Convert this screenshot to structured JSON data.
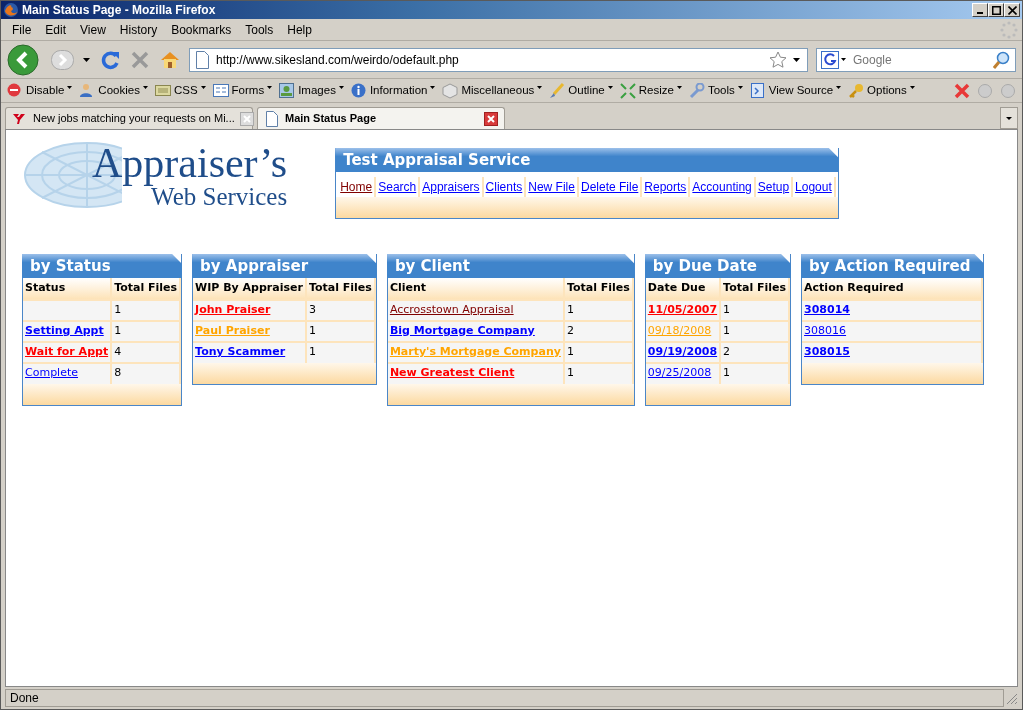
{
  "window": {
    "title": "Main Status Page - Mozilla Firefox"
  },
  "menu": [
    "File",
    "Edit",
    "View",
    "History",
    "Bookmarks",
    "Tools",
    "Help"
  ],
  "address": {
    "value": "http://www.sikesland.com/weirdo/odefault.php"
  },
  "search": {
    "placeholder": "Google"
  },
  "toolbar": [
    "Disable",
    "Cookies",
    "CSS",
    "Forms",
    "Images",
    "Information",
    "Miscellaneous",
    "Outline",
    "Resize",
    "Tools",
    "View Source",
    "Options"
  ],
  "tabs": [
    {
      "label": "New jobs matching your requests on Mi...",
      "selected": false
    },
    {
      "label": "Main Status Page",
      "selected": true
    }
  ],
  "page": {
    "logo": {
      "line1": "Appraiser’s",
      "line2": "Web Services"
    },
    "service": {
      "title": "Test Appraisal Service",
      "nav": [
        {
          "label": "Home",
          "color": "#800000"
        },
        {
          "label": "Search",
          "color": "#0000ff"
        },
        {
          "label": "Appraisers",
          "color": "#0000ff"
        },
        {
          "label": "Clients",
          "color": "#0000ff"
        },
        {
          "label": "New File",
          "color": "#0000ff"
        },
        {
          "label": "Delete File",
          "color": "#0000ff"
        },
        {
          "label": "Reports",
          "color": "#0000ff"
        },
        {
          "label": "Accounting",
          "color": "#0000ff"
        },
        {
          "label": "Setup",
          "color": "#0000ff"
        },
        {
          "label": "Logout",
          "color": "#0000ff"
        }
      ]
    },
    "panels": [
      {
        "title": "by Status",
        "columns": [
          "Status",
          "Total Files"
        ],
        "rows": [
          {
            "count": "1"
          },
          {
            "link": {
              "text": "Setting Appt",
              "color": "#0000ff",
              "bold": true
            },
            "count": "1"
          },
          {
            "link": {
              "text": "Wait for Appt",
              "color": "#ff0000",
              "bold": true
            },
            "count": "4"
          },
          {
            "link": {
              "text": "Complete",
              "color": "#0000ff",
              "bold": false
            },
            "count": "8"
          }
        ]
      },
      {
        "title": "by Appraiser",
        "columns": [
          "WIP By Appraiser",
          "Total Files"
        ],
        "rows": [
          {
            "link": {
              "text": "John Praiser",
              "color": "#ff0000",
              "bold": true
            },
            "count": "3"
          },
          {
            "link": {
              "text": "Paul Praiser",
              "color": "#ffa500",
              "bold": true
            },
            "count": "1"
          },
          {
            "link": {
              "text": "Tony Scammer",
              "color": "#0000ff",
              "bold": true
            },
            "count": "1"
          }
        ]
      },
      {
        "title": "by Client",
        "columns": [
          "Client",
          "Total Files"
        ],
        "rows": [
          {
            "link": {
              "text": "Accrosstown Appraisal",
              "color": "#800000",
              "bold": false
            },
            "count": "1"
          },
          {
            "link": {
              "text": "Big Mortgage Company",
              "color": "#0000ff",
              "bold": true
            },
            "count": "2"
          },
          {
            "link": {
              "text": "Marty's Mortgage Company",
              "color": "#ffa500",
              "bold": true
            },
            "count": "1"
          },
          {
            "link": {
              "text": "New Greatest Client",
              "color": "#ff0000",
              "bold": true
            },
            "count": "1"
          }
        ]
      },
      {
        "title": "by Due Date",
        "columns": [
          "Date Due",
          "Total Files"
        ],
        "rows": [
          {
            "link": {
              "text": "11/05/2007",
              "color": "#ff0000",
              "bold": true
            },
            "count": "1"
          },
          {
            "link": {
              "text": "09/18/2008",
              "color": "#ffa500",
              "bold": false
            },
            "count": "1"
          },
          {
            "link": {
              "text": "09/19/2008",
              "color": "#0000ff",
              "bold": true
            },
            "count": "2"
          },
          {
            "link": {
              "text": "09/25/2008",
              "color": "#0000ff",
              "bold": false
            },
            "count": "1"
          }
        ]
      },
      {
        "title": "by Action Required",
        "columns": [
          "Action Required"
        ],
        "rows": [
          {
            "link": {
              "text": "308014",
              "color": "#0000ff",
              "bold": true
            }
          },
          {
            "link": {
              "text": "308016",
              "color": "#0000ff",
              "bold": false
            }
          },
          {
            "link": {
              "text": "308015",
              "color": "#0000ff",
              "bold": true
            }
          }
        ]
      }
    ]
  },
  "status_bar": "Done"
}
